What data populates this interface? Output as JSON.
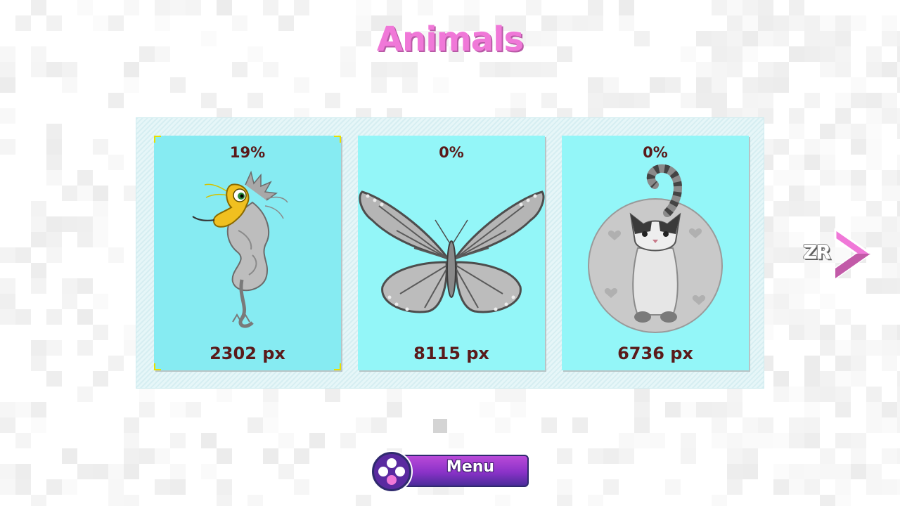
{
  "screen": {
    "title": "Animals"
  },
  "cards": [
    {
      "name": "dragon",
      "percent": "19%",
      "pixels": "2302 px",
      "selected": true
    },
    {
      "name": "butterfly",
      "percent": "0%",
      "pixels": "8115 px",
      "selected": false
    },
    {
      "name": "cat",
      "percent": "0%",
      "pixels": "6736 px",
      "selected": false
    }
  ],
  "nav": {
    "next_button_label": "ZR"
  },
  "footer": {
    "menu_label": "Menu"
  },
  "colors": {
    "title": "#f078d8",
    "card_bg": "#93f6f8",
    "card_text": "#5a1a1a",
    "accent_pink": "#f078d8",
    "menu_purple": "#8a32c8"
  }
}
